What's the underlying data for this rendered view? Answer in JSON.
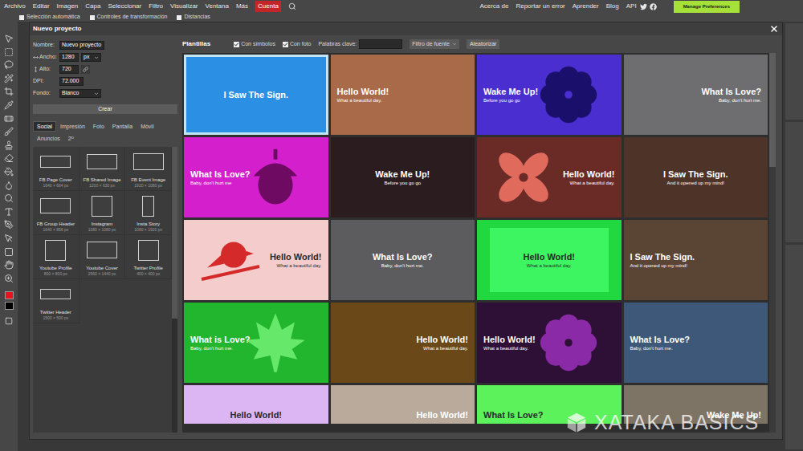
{
  "menu": [
    {
      "label": "Archivo",
      "highlighted": false
    },
    {
      "label": "Editar",
      "highlighted": false
    },
    {
      "label": "Imagen",
      "highlighted": false
    },
    {
      "label": "Capa",
      "highlighted": false
    },
    {
      "label": "Seleccionar",
      "highlighted": false
    },
    {
      "label": "Filtro",
      "highlighted": false
    },
    {
      "label": "Visualizar",
      "highlighted": false
    },
    {
      "label": "Ventana",
      "highlighted": false
    },
    {
      "label": "Más",
      "highlighted": false
    },
    {
      "label": "Cuenta",
      "highlighted": true
    }
  ],
  "top_links": [
    "Acerca de",
    "Reportar un error",
    "Aprender",
    "Blog",
    "API"
  ],
  "preferences_button": "Manage Preferences",
  "options_bar": [
    {
      "label": "Selección automática",
      "checked": false
    },
    {
      "label": "Controles de transformación",
      "checked": false
    },
    {
      "label": "Distancias",
      "checked": false
    }
  ],
  "tool_colors": {
    "foreground": "#e8121c",
    "background": "#000000"
  },
  "dialog": {
    "title": "Nuevo proyecto",
    "fields": [
      {
        "kind": "text",
        "label": "Nombre:",
        "value": "Nuevo proyecto"
      },
      {
        "kind": "width",
        "label": "Ancho:",
        "value": "1280",
        "unit": "px"
      },
      {
        "kind": "height",
        "label": "Alto:",
        "value": "720"
      },
      {
        "kind": "number",
        "label": "DPI:",
        "value": "72.000"
      },
      {
        "kind": "select",
        "label": "Fondo:",
        "value": "Blanco"
      }
    ],
    "create_button": "Crear",
    "tabs": [
      {
        "label": "Social",
        "selected": true
      },
      {
        "label": "Impresión",
        "selected": false
      },
      {
        "label": "Foto",
        "selected": false
      },
      {
        "label": "Pantalla",
        "selected": false
      },
      {
        "label": "Móvil",
        "selected": false
      },
      {
        "label": "Anuncios",
        "selected": false
      },
      {
        "label": "2ᴰ",
        "selected": false
      }
    ],
    "presets": [
      {
        "name": "FB Page Cover",
        "size": "1640 × 664 px"
      },
      {
        "name": "FB Shared Image",
        "size": "1200 × 630 px"
      },
      {
        "name": "FB Event Image",
        "size": "1920 × 1080 px"
      },
      {
        "name": "FB Group Header",
        "size": "1640 × 856 px"
      },
      {
        "name": "Instagram",
        "size": "1080 × 1080 px"
      },
      {
        "name": "Insta Story",
        "size": "1080 × 1920 px"
      },
      {
        "name": "Youtube Profile",
        "size": "800 × 800 px"
      },
      {
        "name": "Youtube Cover",
        "size": "2560 × 1440 px"
      },
      {
        "name": "Twitter Profile",
        "size": "400 × 400 px"
      },
      {
        "name": "Twitter Header",
        "size": "1500 × 500 px"
      }
    ],
    "templates_panel": {
      "title": "Plantillas",
      "checkboxes": [
        {
          "label": "Con símbolos",
          "checked": true
        },
        {
          "label": "Con foto",
          "checked": true
        }
      ],
      "keywords_label": "Palabras clave:",
      "keywords_value": "",
      "font_filter": "Filtro de fuente",
      "randomize": "Aleatorizar"
    },
    "templates": [
      {
        "title": "I Saw The Sign.",
        "subtitle": "",
        "kind": "plain",
        "color": "#2b8fe3",
        "align": "center",
        "selected": true
      },
      {
        "title": "Hello World!",
        "subtitle": "What a beautiful day.",
        "kind": "photo",
        "color": "#a86a48",
        "align": "left",
        "selected": false
      },
      {
        "title": "Wake Me Up!",
        "subtitle": "Before you go go",
        "kind": "symbol",
        "shape": "flower",
        "shape_color": "#1a0f6b",
        "color": "#4a2ed0",
        "align": "left",
        "selected": false
      },
      {
        "title": "What Is Love?",
        "subtitle": "Baby, don't hurt me.",
        "kind": "photo",
        "color": "#6e6e70",
        "align": "right",
        "selected": false
      },
      {
        "title": "What Is Love?",
        "subtitle": "Baby, don't hurt me",
        "kind": "symbol",
        "shape": "acorn",
        "shape_color": "#6e0a62",
        "color": "#d41fcc",
        "align": "left",
        "selected": false
      },
      {
        "title": "Wake Me Up!",
        "subtitle": "Before you go go",
        "kind": "photo",
        "color": "#2b1d1f",
        "align": "center",
        "selected": false
      },
      {
        "title": "Hello World!",
        "subtitle": "What a beautiful day.",
        "kind": "symbol",
        "shape": "petals",
        "shape_color": "#e06a5c",
        "color": "#6a2a26",
        "align": "right",
        "selected": false
      },
      {
        "title": "I Saw The Sign.",
        "subtitle": "And it opened up my mind!",
        "kind": "photo",
        "color": "#4e3328",
        "align": "center",
        "selected": false
      },
      {
        "title": "Hello World!",
        "subtitle": "What a beautiful day.",
        "kind": "symbol",
        "shape": "bird",
        "shape_color": "#d42a2a",
        "color": "#f5cccc",
        "align": "right",
        "selected": false
      },
      {
        "title": "What Is Love?",
        "subtitle": "Baby, don't hurt me.",
        "kind": "photo",
        "color": "#5c5c5e",
        "align": "center",
        "selected": false
      },
      {
        "title": "Hello World!",
        "subtitle": "What a beautiful day.",
        "kind": "symbol",
        "shape": "square",
        "shape_color": "#3cf560",
        "color": "#22d840",
        "align": "center",
        "selected": false
      },
      {
        "title": "I Saw The Sign.",
        "subtitle": "And it opened up my mind!",
        "kind": "photo",
        "color": "#5a4434",
        "align": "left",
        "selected": false
      },
      {
        "title": "What is Love?",
        "subtitle": "Baby, don't hurt me.",
        "kind": "symbol",
        "shape": "leaf",
        "shape_color": "#66e86a",
        "color": "#22b52e",
        "align": "left",
        "selected": false
      },
      {
        "title": "Hello World!",
        "subtitle": "What a beautiful day.",
        "kind": "photo",
        "color": "#6b4818",
        "align": "right",
        "selected": false
      },
      {
        "title": "Hello World!",
        "subtitle": "What a beautiful day.",
        "kind": "symbol",
        "shape": "flower",
        "shape_color": "#8a2aa6",
        "color": "#2e1036",
        "align": "left",
        "selected": false
      },
      {
        "title": "What Is Love?",
        "subtitle": "Baby, don't hurt me.",
        "kind": "photo",
        "color": "#3d5878",
        "align": "left",
        "selected": false
      },
      {
        "title": "Hello World!",
        "subtitle": "",
        "kind": "plain",
        "color": "#dcb6f2",
        "align": "center",
        "selected": false
      },
      {
        "title": "Hello World!",
        "subtitle": "",
        "kind": "photo",
        "color": "#b9aa9c",
        "align": "right",
        "selected": false
      },
      {
        "title": "What Is Love?",
        "subtitle": "",
        "kind": "plain",
        "color": "#5cf25c",
        "align": "left",
        "selected": false
      },
      {
        "title": "Wake Me Up!",
        "subtitle": "",
        "kind": "photo",
        "color": "#7d7466",
        "align": "right",
        "selected": false
      }
    ]
  },
  "watermark": "XATAKA BASICS"
}
